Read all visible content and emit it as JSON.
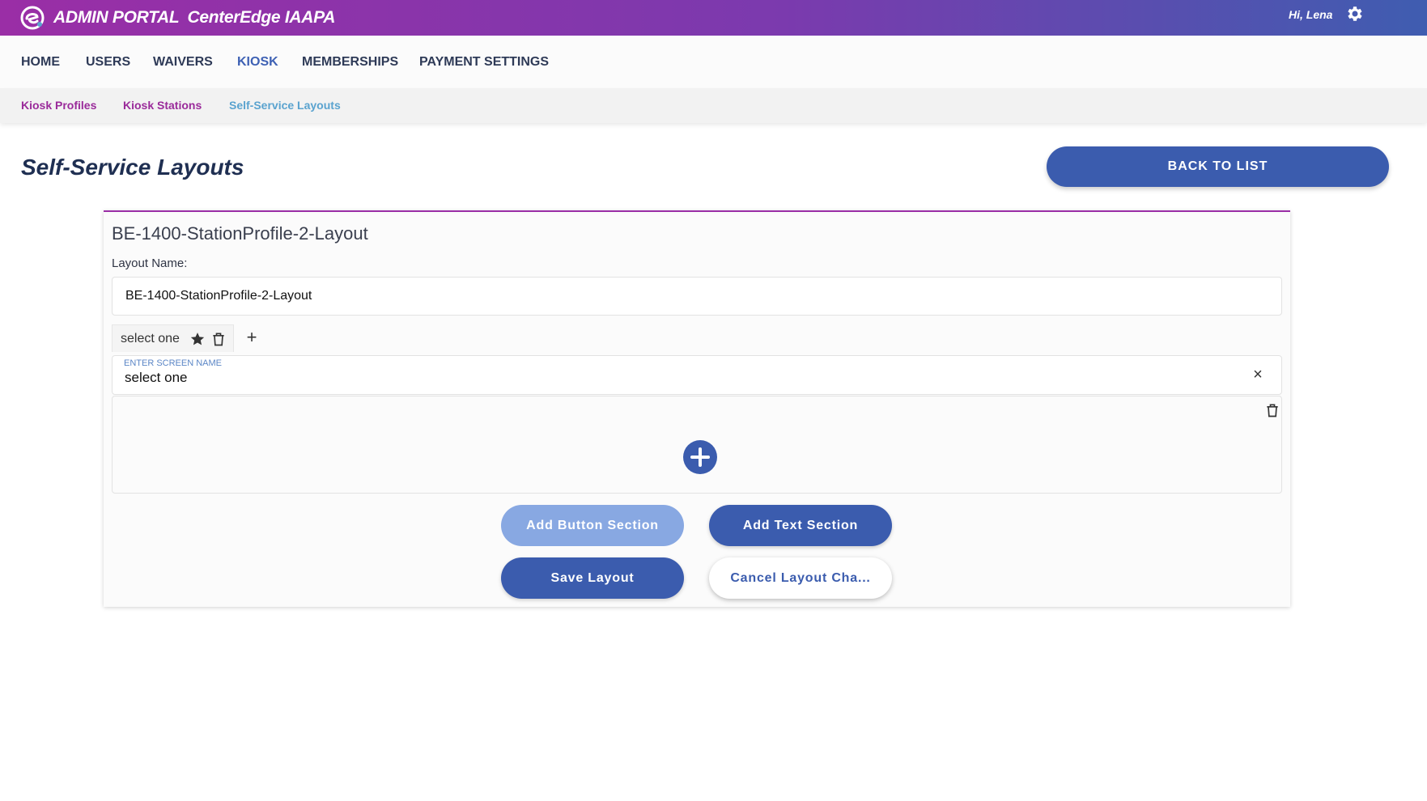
{
  "header": {
    "brand_portal": "ADMIN PORTAL",
    "brand_name": "CenterEdge IAAPA",
    "greeting": "Hi, Lena",
    "logo_icon": "centeredge-logo-icon",
    "settings_icon": "gear-icon"
  },
  "main_nav": {
    "items": [
      {
        "label": "HOME"
      },
      {
        "label": "USERS"
      },
      {
        "label": "WAIVERS"
      },
      {
        "label": "KIOSK",
        "active": true
      },
      {
        "label": "MEMBERSHIPS"
      },
      {
        "label": "PAYMENT SETTINGS"
      }
    ]
  },
  "sub_nav": {
    "items": [
      {
        "label": "Kiosk Profiles"
      },
      {
        "label": "Kiosk Stations"
      },
      {
        "label": "Self-Service Layouts",
        "active": true
      }
    ]
  },
  "page": {
    "title": "Self-Service Layouts",
    "back_button": "BACK TO LIST"
  },
  "layout": {
    "heading": "BE-1400-StationProfile-2-Layout",
    "name_label": "Layout Name:",
    "name_value": "BE-1400-StationProfile-2-Layout",
    "tab": {
      "label": "select one",
      "star_icon": "star-icon",
      "delete_icon": "trash-icon"
    },
    "tab_add": "+",
    "screen_name_label": "ENTER SCREEN NAME",
    "screen_name_value": "select one",
    "clear_icon": "×"
  },
  "actions": {
    "add_button_section": "Add Button Section",
    "add_text_section": "Add Text Section",
    "save_layout": "Save Layout",
    "cancel_layout": "Cancel Layout Cha..."
  },
  "colors": {
    "accent": "#3b5cae",
    "accent_light": "#88a8e2",
    "brand_purple": "#9a2ea6",
    "sub_nav_link": "#9a2a9a",
    "sub_nav_active": "#5aa3cf"
  }
}
